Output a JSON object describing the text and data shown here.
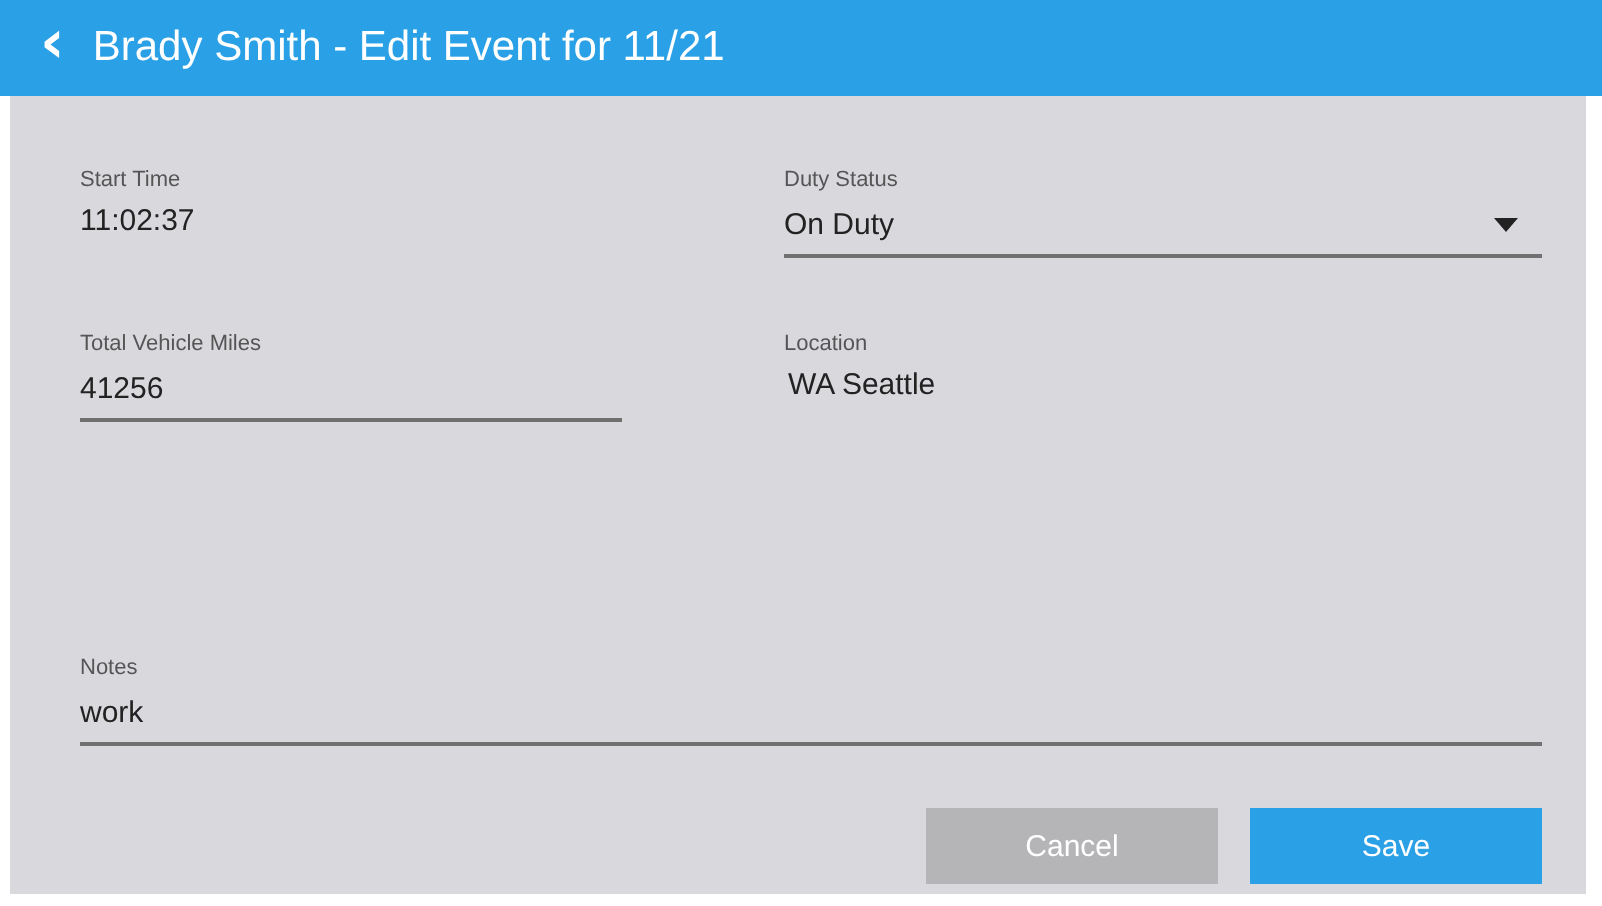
{
  "header": {
    "back_icon": "‹",
    "title": "Brady Smith - Edit Event for 11/21"
  },
  "fields": [
    {
      "kind": "text",
      "label": "Start Time",
      "value": "11:02:37"
    },
    {
      "kind": "select",
      "label": "Duty Status",
      "value": "On Duty"
    },
    {
      "kind": "input",
      "label": "Total Vehicle Miles",
      "value": "41256"
    },
    {
      "kind": "text",
      "label": "Location",
      "value": "WA Seattle"
    },
    {
      "kind": "wide_input",
      "label": "Notes",
      "value": "work"
    }
  ],
  "buttons": [
    {
      "label": "Cancel",
      "kind": "secondary"
    },
    {
      "label": "Save",
      "kind": "primary"
    }
  ]
}
